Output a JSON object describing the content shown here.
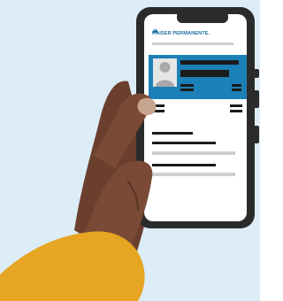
{
  "app": {
    "brand_name": "KAISER PERMANENTE.",
    "brand_color": "#1c6fa3"
  },
  "scene": {
    "background_color": "#dcedf8",
    "phone_color": "#2b2b2b",
    "screen_color": "#ffffff",
    "card_color": "#1c80b8",
    "skin_color": "#7a4a36",
    "sleeve_color": "#e6a523",
    "icons": [
      "kp-logo-icon",
      "avatar-icon"
    ]
  }
}
